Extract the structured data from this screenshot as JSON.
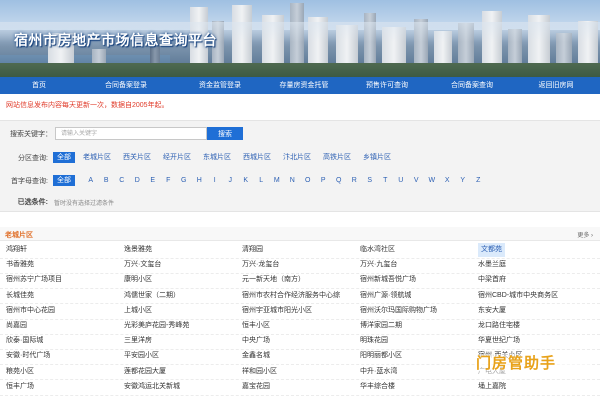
{
  "site": {
    "title": "宿州市房地产市场信息查询平台"
  },
  "nav": [
    {
      "label": "首页"
    },
    {
      "label": "合同备案登录"
    },
    {
      "label": "资金监管登录"
    },
    {
      "label": "存量房资金托管"
    },
    {
      "label": "预售许可查询"
    },
    {
      "label": "合同备案查询"
    },
    {
      "label": "返回旧房网"
    }
  ],
  "notice": "网站信息发布内容每天更新一次，数据自2005年起。",
  "search": {
    "label": "搜索关键字：",
    "placeholder": "请输入关键字",
    "button": "搜索"
  },
  "district_filter": {
    "label": "分区查询:",
    "options": [
      "全部",
      "老城片区",
      "西关片区",
      "经开片区",
      "东城片区",
      "西城片区",
      "汴北片区",
      "高铁片区",
      "乡镇片区"
    ],
    "selected": "全部"
  },
  "letter_filter": {
    "label": "首字母查询:",
    "all": "全部",
    "letters": [
      "A",
      "B",
      "C",
      "D",
      "E",
      "F",
      "G",
      "H",
      "I",
      "J",
      "K",
      "L",
      "M",
      "N",
      "O",
      "P",
      "Q",
      "R",
      "S",
      "T",
      "U",
      "V",
      "W",
      "X",
      "Y",
      "Z"
    ]
  },
  "conditions": {
    "label": "已选条件:",
    "empty_text": "暂时没有选择过滤条件"
  },
  "results": {
    "section_title": "老城片区",
    "more": "更多 ›",
    "rows": [
      [
        "鸿翔轩",
        "逸景雅苑",
        "清翔园",
        "临水湾社区",
        "文都苑"
      ],
      [
        "书香雅苑",
        "万兴·文玺台",
        "万兴·龙玺台",
        "万兴·九玺台",
        "水墨兰庭"
      ],
      [
        "宿州苏宁广场项目",
        "康明小区",
        "元一新天地（南方）",
        "宿州新城吾悦广场",
        "中梁首府"
      ],
      [
        "长城佳苑",
        "鸿儒世家（二期）",
        "宿州市农村合作经济服务中心综",
        "宿州广源·领航城",
        "宿州CBD-城市中央商务区"
      ],
      [
        "宿州市中心花园",
        "上城小区",
        "宿州宇亚城市阳光小区",
        "宿州沃尔玛国际购物广场",
        "东安大厦"
      ],
      [
        "尚嘉园",
        "光彩美庐花园-秀峰苑",
        "恒丰小区",
        "博洋家园二期",
        "龙口路住宅楼"
      ],
      [
        "欣泰·国际城",
        "三里洋房",
        "中央广场",
        "明珠花园",
        "华夏世纪广场"
      ],
      [
        "安徽·时代广场",
        "平安园小区",
        "金鑫名城",
        "阳明丽都小区",
        "宿州·西关小区"
      ],
      [
        "粮苑小区",
        "莲都花园大厦",
        "祥和园小区",
        "中升·蓝水湾",
        "广电大厦"
      ],
      [
        "恒丰广场",
        "安徽鸿运北关新城",
        "嘉宝花园",
        "华丰综合楼",
        "埇上嘉院"
      ]
    ],
    "highlighted": "文都苑"
  },
  "watermark": "门房管助手"
}
